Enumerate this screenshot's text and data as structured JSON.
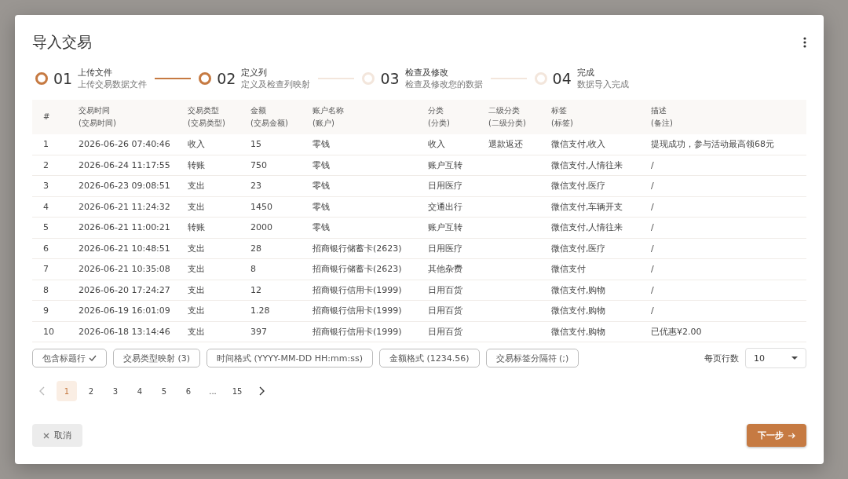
{
  "dialog": {
    "title": "导入交易"
  },
  "steps": [
    {
      "number": "01",
      "title": "上传文件",
      "subtitle": "上传交易数据文件",
      "active": true
    },
    {
      "number": "02",
      "title": "定义列",
      "subtitle": "定义及检查列映射",
      "active": true
    },
    {
      "number": "03",
      "title": "检查及修改",
      "subtitle": "检查及修改您的数据",
      "active": false
    },
    {
      "number": "04",
      "title": "完成",
      "subtitle": "数据导入完成",
      "active": false
    }
  ],
  "table": {
    "columns": [
      {
        "label": "#"
      },
      {
        "label": "交易时间",
        "mapping": "(交易时间)"
      },
      {
        "label": "交易类型",
        "mapping": "(交易类型)"
      },
      {
        "label": "金额",
        "mapping": "(交易金额)"
      },
      {
        "label": "账户名称",
        "mapping": "(账户)"
      },
      {
        "label": "分类",
        "mapping": "(分类)"
      },
      {
        "label": "二级分类",
        "mapping": "(二级分类)"
      },
      {
        "label": "标签",
        "mapping": "(标签)"
      },
      {
        "label": "描述",
        "mapping": "(备注)"
      }
    ],
    "rows": [
      [
        "1",
        "2026-06-26 07:40:46",
        "收入",
        "15",
        "零钱",
        "收入",
        "退款返还",
        "微信支付,收入",
        "提现成功，参与活动最高领68元"
      ],
      [
        "2",
        "2026-06-24 11:17:55",
        "转账",
        "750",
        "零钱",
        "账户互转",
        "",
        "微信支付,人情往来",
        "/"
      ],
      [
        "3",
        "2026-06-23 09:08:51",
        "支出",
        "23",
        "零钱",
        "日用医疗",
        "",
        "微信支付,医疗",
        "/"
      ],
      [
        "4",
        "2026-06-21 11:24:32",
        "支出",
        "1450",
        "零钱",
        "交通出行",
        "",
        "微信支付,车辆开支",
        "/"
      ],
      [
        "5",
        "2026-06-21 11:00:21",
        "转账",
        "2000",
        "零钱",
        "账户互转",
        "",
        "微信支付,人情往来",
        "/"
      ],
      [
        "6",
        "2026-06-21 10:48:51",
        "支出",
        "28",
        "招商银行储蓄卡(2623)",
        "日用医疗",
        "",
        "微信支付,医疗",
        "/"
      ],
      [
        "7",
        "2026-06-21 10:35:08",
        "支出",
        "8",
        "招商银行储蓄卡(2623)",
        "其他杂费",
        "",
        "微信支付",
        "/"
      ],
      [
        "8",
        "2026-06-20 17:24:27",
        "支出",
        "12",
        "招商银行信用卡(1999)",
        "日用百货",
        "",
        "微信支付,购物",
        "/"
      ],
      [
        "9",
        "2026-06-19 16:01:09",
        "支出",
        "1.28",
        "招商银行信用卡(1999)",
        "日用百货",
        "",
        "微信支付,购物",
        "/"
      ],
      [
        "10",
        "2026-06-18 13:14:46",
        "支出",
        "397",
        "招商银行信用卡(1999)",
        "日用百货",
        "",
        "微信支付,购物",
        "已优惠¥2.00"
      ]
    ]
  },
  "options": [
    {
      "label": "包含标题行",
      "kind": "toggle",
      "checked": true
    },
    {
      "label": "交易类型映射 (3)",
      "kind": "menu"
    },
    {
      "label": "时间格式 (YYYY-MM-DD HH:mm:ss)",
      "kind": "menu"
    },
    {
      "label": "金额格式 (1234.56)",
      "kind": "menu"
    },
    {
      "label": "交易标签分隔符 (;)",
      "kind": "menu"
    }
  ],
  "rows_per_page": {
    "label": "每页行数",
    "value": "10"
  },
  "pagination": {
    "previous_disabled": true,
    "next_disabled": false,
    "pages": [
      {
        "label": "1",
        "selected": true
      },
      {
        "label": "2",
        "selected": false
      },
      {
        "label": "3",
        "selected": false
      },
      {
        "label": "4",
        "selected": false
      },
      {
        "label": "5",
        "selected": false
      },
      {
        "label": "6",
        "selected": false
      },
      {
        "label": "...",
        "selected": false
      },
      {
        "label": "15",
        "selected": false
      }
    ]
  },
  "buttons": {
    "cancel": "取消",
    "next": "下一步"
  }
}
